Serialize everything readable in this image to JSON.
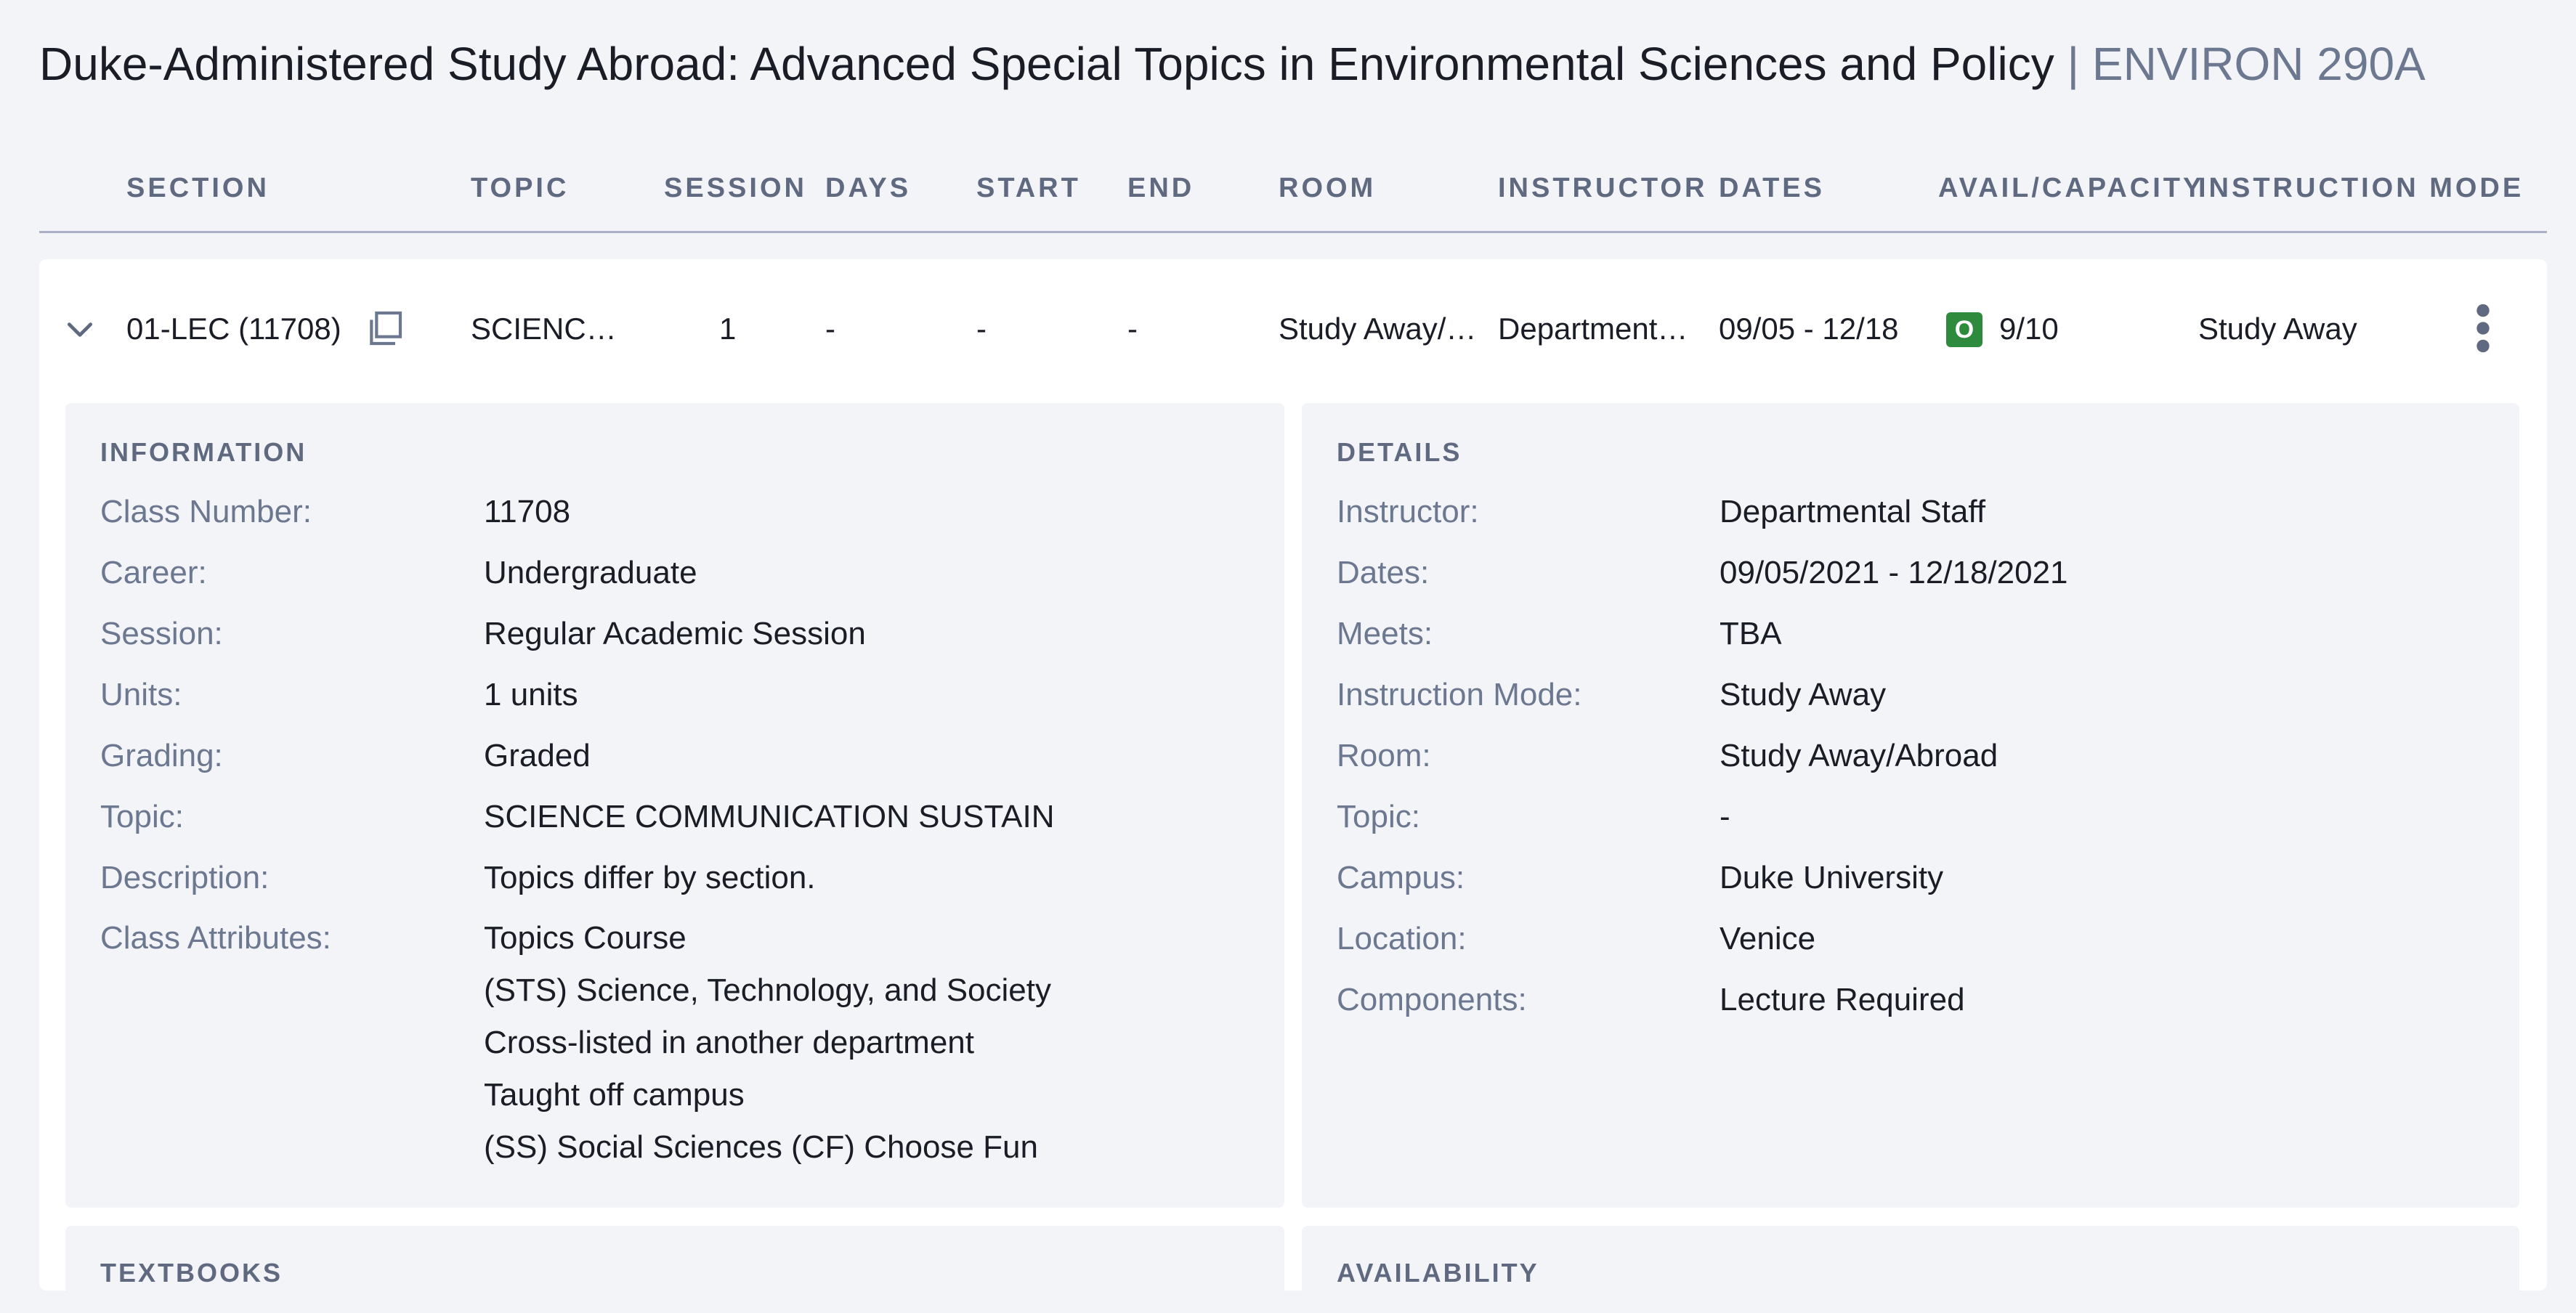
{
  "page": {
    "title": "Duke-Administered Study Abroad: Advanced Special Topics in Environmental Sciences and Policy",
    "course_code": "| ENVIRON 290A"
  },
  "table": {
    "headers": {
      "section": "SECTION",
      "topic": "TOPIC",
      "session": "SESSION",
      "days": "DAYS",
      "start": "START",
      "end": "END",
      "room": "ROOM",
      "instructor": "INSTRUCTOR",
      "dates": "DATES",
      "avail": "AVAIL/CAPACITY",
      "mode": "INSTRUCTION MODE"
    },
    "row": {
      "section": "01-LEC (11708)",
      "topic": "SCIENC…",
      "session": "1",
      "days": "-",
      "start": "-",
      "end": "-",
      "room": "Study Away/…",
      "instructor": "Department…",
      "dates": "09/05 - 12/18",
      "status_badge": "O",
      "status_color": "#2e8b3e",
      "avail": "9/10",
      "mode": "Study Away",
      "expand_icon": "chevron-down-icon",
      "copy_icon": "copy-icon",
      "more_icon": "more-vertical-icon"
    }
  },
  "information": {
    "title": "INFORMATION",
    "fields": [
      {
        "label": "Class Number:",
        "value": "11708"
      },
      {
        "label": "Career:",
        "value": "Undergraduate"
      },
      {
        "label": "Session:",
        "value": "Regular Academic Session"
      },
      {
        "label": "Units:",
        "value": "1 units"
      },
      {
        "label": "Grading:",
        "value": "Graded"
      },
      {
        "label": "Topic:",
        "value": "SCIENCE COMMUNICATION SUSTAIN"
      },
      {
        "label": "Description:",
        "value": "Topics differ by section."
      }
    ],
    "attributes_label": "Class Attributes:",
    "attributes": [
      "Topics Course",
      "(STS) Science, Technology, and Society",
      "Cross-listed in another department",
      "Taught off campus",
      "(SS) Social Sciences (CF) Choose Fun"
    ]
  },
  "details": {
    "title": "DETAILS",
    "fields": [
      {
        "label": "Instructor:",
        "value": "Departmental Staff"
      },
      {
        "label": "Dates:",
        "value": "09/05/2021 - 12/18/2021"
      },
      {
        "label": "Meets:",
        "value": "TBA"
      },
      {
        "label": "Instruction Mode:",
        "value": "Study Away"
      },
      {
        "label": "Room:",
        "value": "Study Away/Abroad"
      },
      {
        "label": "Topic:",
        "value": "-"
      },
      {
        "label": "Campus:",
        "value": "Duke University"
      },
      {
        "label": "Location:",
        "value": "Venice"
      },
      {
        "label": "Components:",
        "value": "Lecture Required"
      }
    ]
  },
  "lower_panels": {
    "textbooks_title": "TEXTBOOKS",
    "availability_title": "AVAILABILITY"
  }
}
